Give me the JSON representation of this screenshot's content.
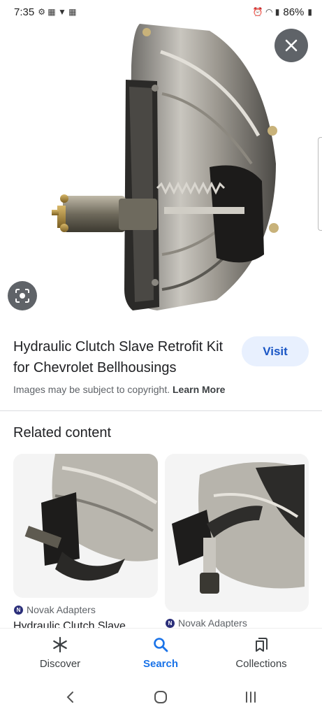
{
  "status_bar": {
    "time": "7:35",
    "battery": "86%"
  },
  "hero": {
    "image_subject": "hydraulic clutch slave on bellhousing"
  },
  "result": {
    "title": "Hydraulic Clutch Slave Retrofit Kit for Chevrolet Bellhousings",
    "visit_label": "Visit",
    "copyright_text": "Images may be subject to copyright.",
    "learn_more_label": "Learn More"
  },
  "related": {
    "heading": "Related content",
    "cards": [
      {
        "source": "Novak Adapters",
        "title": "Hydraulic Clutch Slave"
      },
      {
        "source": "Novak Adapters",
        "title": ""
      }
    ]
  },
  "bottom_nav": {
    "items": [
      {
        "label": "Discover",
        "icon": "asterisk-icon"
      },
      {
        "label": "Search",
        "icon": "search-icon",
        "active": true
      },
      {
        "label": "Collections",
        "icon": "collections-icon"
      }
    ]
  },
  "colors": {
    "accent": "#1a73e8",
    "visit_bg": "#e8f0fe",
    "overlay_button": "#5f6368"
  }
}
